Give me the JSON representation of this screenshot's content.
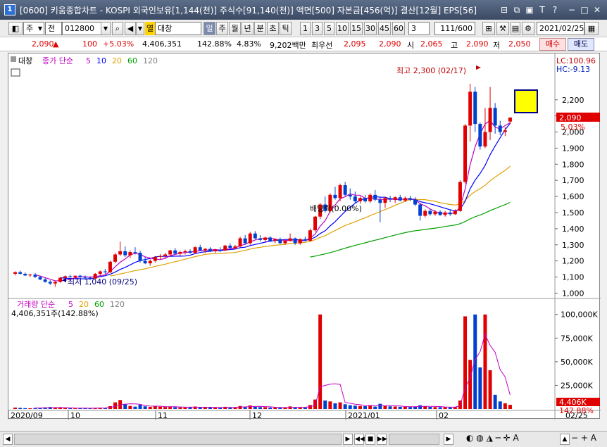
{
  "window": {
    "app_icon": "1",
    "title": "[0600] 키움종합차트 - KOSPI 외국인보유[1,144(천)] 주식수[91,140(천)] 액면[500] 자본금[456(억)] 결산[12월] EPS[56]"
  },
  "toolbar": {
    "market": "주",
    "range": "전",
    "code": "012800",
    "name_tag": "열",
    "name": "대창",
    "periods": [
      "일",
      "주",
      "월",
      "년",
      "분",
      "초",
      "틱"
    ],
    "minutes": [
      "1",
      "3",
      "5",
      "10",
      "15",
      "30",
      "45",
      "60"
    ],
    "interval": "3",
    "count": "111/600",
    "date": "2021/02/25"
  },
  "quote": {
    "price": "2,090",
    "arrow": "▲",
    "change": "100",
    "change_pct": "+5.03%",
    "volume": "4,406,351",
    "volume_pct": "142.88%",
    "turnover": "4.83%",
    "amount": "9,202백만",
    "label_priority": "최우선",
    "ask": "2,095",
    "bid": "2,090",
    "label_open": "시",
    "open": "2,065",
    "label_high": "고",
    "high": "2,090",
    "label_low": "저",
    "low": "2,050",
    "buy_label": "매수",
    "sell_label": "매도"
  },
  "price_legend": {
    "name": "대창",
    "ma_title": "종가 단순",
    "ma_periods": [
      "5",
      "10",
      "20",
      "60",
      "120"
    ]
  },
  "volume_legend": {
    "title": "거래량 단순",
    "ma_periods": [
      "5",
      "20",
      "60",
      "120"
    ],
    "value": "4,406,351주(142.88%)"
  },
  "annotations": {
    "high": "최고 2,300 (02/17)",
    "low": "최저 1,040 (09/25)",
    "dividend": "배당락(0.00%)",
    "lc": "LC:100.96",
    "hc": "HC:-9.13"
  },
  "price_axis": [
    "2,200",
    "2,100",
    "2,000",
    "1,900",
    "1,800",
    "1,700",
    "1,600",
    "1,500",
    "1,400",
    "1,300",
    "1,200",
    "1,100",
    "1,000"
  ],
  "price_tag": {
    "value": "2,090",
    "pct": "5.03%"
  },
  "volume_axis": [
    "100,000K",
    "75,000K",
    "50,000K",
    "25,000K"
  ],
  "volume_tag": {
    "value": "4,406K",
    "pct": "142.88%"
  },
  "date_axis": [
    "2020/09",
    "10",
    "11",
    "12",
    "2021/01",
    "02",
    "02/25"
  ],
  "colors": {
    "up": "#e00000",
    "down": "#0040d0",
    "ma5": "#c000c0",
    "ma10": "#0000ff",
    "ma20": "#e0a000",
    "ma60": "#00a000",
    "ma120": "#808080"
  },
  "chart_data": {
    "type": "candlestick",
    "ylim": [
      980,
      2330
    ],
    "candles": [
      [
        1120,
        1135,
        1110,
        1130
      ],
      [
        1130,
        1140,
        1115,
        1120
      ],
      [
        1120,
        1128,
        1105,
        1110
      ],
      [
        1110,
        1120,
        1100,
        1115
      ],
      [
        1115,
        1125,
        1095,
        1100
      ],
      [
        1100,
        1108,
        1080,
        1085
      ],
      [
        1085,
        1095,
        1065,
        1070
      ],
      [
        1070,
        1080,
        1050,
        1060
      ],
      [
        1060,
        1075,
        1040,
        1070
      ],
      [
        1070,
        1100,
        1065,
        1095
      ],
      [
        1095,
        1110,
        1085,
        1105
      ],
      [
        1105,
        1115,
        1095,
        1100
      ],
      [
        1100,
        1110,
        1090,
        1108
      ],
      [
        1108,
        1115,
        1095,
        1100
      ],
      [
        1100,
        1110,
        1085,
        1095
      ],
      [
        1095,
        1105,
        1080,
        1090
      ],
      [
        1090,
        1125,
        1088,
        1120
      ],
      [
        1120,
        1140,
        1110,
        1135
      ],
      [
        1135,
        1150,
        1120,
        1130
      ],
      [
        1130,
        1200,
        1125,
        1195
      ],
      [
        1195,
        1250,
        1185,
        1240
      ],
      [
        1240,
        1320,
        1230,
        1260
      ],
      [
        1260,
        1290,
        1225,
        1235
      ],
      [
        1235,
        1265,
        1220,
        1255
      ],
      [
        1255,
        1285,
        1240,
        1250
      ],
      [
        1250,
        1262,
        1190,
        1200
      ],
      [
        1200,
        1225,
        1180,
        1185
      ],
      [
        1185,
        1210,
        1170,
        1200
      ],
      [
        1200,
        1230,
        1190,
        1225
      ],
      [
        1225,
        1242,
        1210,
        1230
      ],
      [
        1230,
        1250,
        1215,
        1240
      ],
      [
        1240,
        1270,
        1230,
        1265
      ],
      [
        1265,
        1280,
        1240,
        1245
      ],
      [
        1245,
        1262,
        1230,
        1255
      ],
      [
        1255,
        1270,
        1240,
        1260
      ],
      [
        1260,
        1272,
        1245,
        1250
      ],
      [
        1250,
        1290,
        1245,
        1285
      ],
      [
        1285,
        1300,
        1260,
        1265
      ],
      [
        1265,
        1280,
        1250,
        1275
      ],
      [
        1275,
        1285,
        1255,
        1260
      ],
      [
        1260,
        1275,
        1250,
        1270
      ],
      [
        1270,
        1285,
        1255,
        1265
      ],
      [
        1265,
        1300,
        1260,
        1295
      ],
      [
        1295,
        1310,
        1275,
        1280
      ],
      [
        1280,
        1300,
        1270,
        1290
      ],
      [
        1290,
        1350,
        1285,
        1340
      ],
      [
        1340,
        1360,
        1300,
        1310
      ],
      [
        1310,
        1380,
        1300,
        1370
      ],
      [
        1370,
        1385,
        1335,
        1340
      ],
      [
        1340,
        1360,
        1320,
        1330
      ],
      [
        1330,
        1350,
        1315,
        1345
      ],
      [
        1345,
        1355,
        1320,
        1325
      ],
      [
        1325,
        1340,
        1310,
        1335
      ],
      [
        1335,
        1345,
        1305,
        1310
      ],
      [
        1310,
        1330,
        1300,
        1325
      ],
      [
        1325,
        1370,
        1320,
        1340
      ],
      [
        1340,
        1345,
        1300,
        1310
      ],
      [
        1310,
        1340,
        1300,
        1335
      ],
      [
        1335,
        1350,
        1320,
        1325
      ],
      [
        1325,
        1400,
        1320,
        1390
      ],
      [
        1390,
        1480,
        1380,
        1475
      ],
      [
        1475,
        1560,
        1460,
        1550
      ],
      [
        1550,
        1600,
        1500,
        1510
      ],
      [
        1510,
        1620,
        1500,
        1610
      ],
      [
        1610,
        1660,
        1580,
        1590
      ],
      [
        1590,
        1680,
        1570,
        1670
      ],
      [
        1670,
        1690,
        1600,
        1610
      ],
      [
        1610,
        1650,
        1580,
        1600
      ],
      [
        1600,
        1630,
        1560,
        1570
      ],
      [
        1570,
        1600,
        1555,
        1590
      ],
      [
        1590,
        1610,
        1560,
        1570
      ],
      [
        1570,
        1620,
        1560,
        1610
      ],
      [
        1610,
        1640,
        1570,
        1580
      ],
      [
        1580,
        1600,
        1440,
        1560
      ],
      [
        1560,
        1600,
        1530,
        1590
      ],
      [
        1590,
        1605,
        1565,
        1580
      ],
      [
        1580,
        1600,
        1560,
        1595
      ],
      [
        1595,
        1610,
        1570,
        1575
      ],
      [
        1575,
        1600,
        1565,
        1590
      ],
      [
        1590,
        1605,
        1570,
        1580
      ],
      [
        1580,
        1595,
        1540,
        1550
      ],
      [
        1550,
        1560,
        1450,
        1480
      ],
      [
        1480,
        1520,
        1470,
        1510
      ],
      [
        1510,
        1525,
        1480,
        1490
      ],
      [
        1490,
        1515,
        1480,
        1505
      ],
      [
        1505,
        1515,
        1480,
        1485
      ],
      [
        1485,
        1510,
        1475,
        1500
      ],
      [
        1500,
        1520,
        1480,
        1490
      ],
      [
        1490,
        1520,
        1485,
        1510
      ],
      [
        1510,
        1700,
        1505,
        1690
      ],
      [
        1690,
        2050,
        1680,
        2040
      ],
      [
        2040,
        2300,
        1940,
        2250
      ],
      [
        2250,
        2280,
        2000,
        2050
      ],
      [
        2050,
        2060,
        1890,
        1910
      ],
      [
        1910,
        2150,
        1900,
        2000
      ],
      [
        2000,
        2280,
        1950,
        2150
      ],
      [
        2150,
        2180,
        1990,
        2040
      ],
      [
        2040,
        2070,
        1980,
        2000
      ],
      [
        2000,
        2030,
        1975,
        2010
      ],
      [
        2065,
        2090,
        2050,
        2090
      ]
    ],
    "volume_k": [
      1500,
      1200,
      900,
      800,
      1100,
      1400,
      1700,
      2100,
      1300,
      1500,
      900,
      800,
      700,
      900,
      1000,
      800,
      1200,
      1500,
      1200,
      3000,
      7000,
      9500,
      5000,
      3200,
      2500,
      4500,
      2800,
      2200,
      3000,
      2400,
      2100,
      2600,
      1900,
      1700,
      1500,
      1800,
      2600,
      1800,
      1600,
      1500,
      1400,
      1700,
      2300,
      1700,
      1600,
      3200,
      2500,
      3800,
      2300,
      2000,
      1900,
      1500,
      1600,
      1400,
      1500,
      2700,
      1700,
      1800,
      1600,
      4200,
      10000,
      100000,
      9000,
      8000,
      6000,
      7000,
      5000,
      4000,
      3500,
      3200,
      3000,
      4000,
      2500,
      5500,
      3000,
      2800,
      2600,
      2400,
      2300,
      2100,
      2500,
      4000,
      2800,
      2200,
      2000,
      1900,
      1800,
      1700,
      2300,
      9000,
      98000,
      52000,
      100000,
      44000,
      100000,
      41000,
      15000,
      8000,
      6000,
      4406
    ]
  }
}
